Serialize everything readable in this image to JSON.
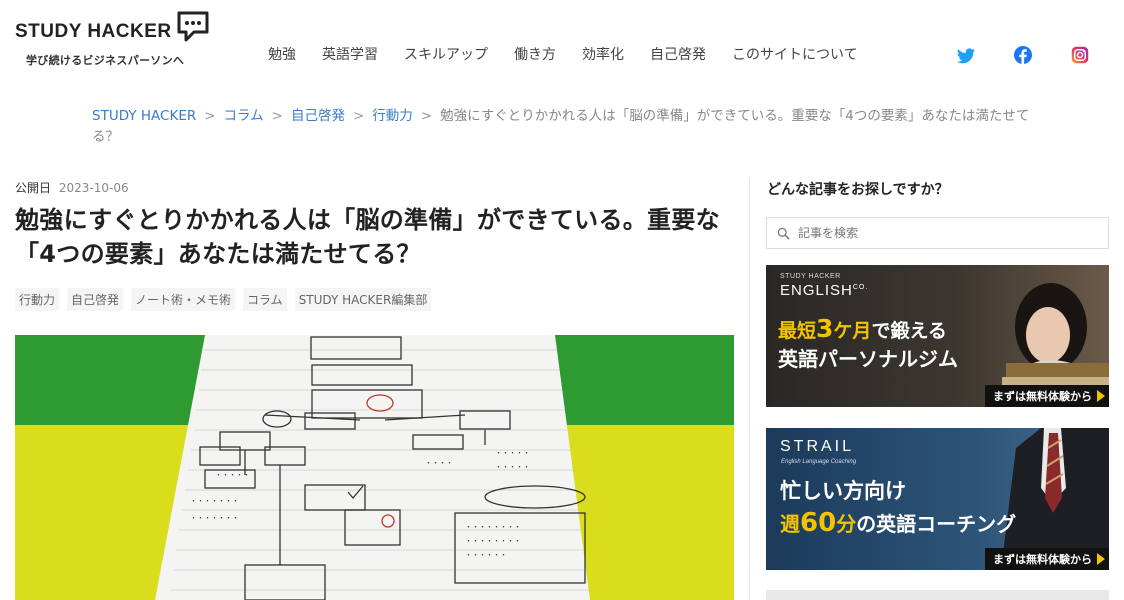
{
  "header": {
    "logo_text": "STUDY HACKER",
    "tagline": "学び続けるビジネスパーソンへ",
    "nav": [
      "勉強",
      "英語学習",
      "スキルアップ",
      "働き方",
      "効率化",
      "自己啓発",
      "このサイトについて"
    ],
    "social": [
      "twitter-icon",
      "facebook-icon",
      "instagram-icon"
    ]
  },
  "breadcrumb": {
    "items": [
      "STUDY HACKER",
      "コラム",
      "自己啓発",
      "行動力"
    ],
    "current": "勉強にすぐとりかかれる人は「脳の準備」ができている。重要な「4つの要素」あなたは満たせてる？",
    "separator": ">"
  },
  "article": {
    "published_label": "公開日",
    "published_date": "2023-10-06",
    "title": "勉強にすぐとりかかれる人は「脳の準備」ができている。重要な「4つの要素」あなたは満たせてる？",
    "tags": [
      "行動力",
      "自己啓発",
      "ノート術・メモ術",
      "コラム",
      "STUDY HACKER編集部"
    ]
  },
  "sidebar": {
    "title": "どんな記事をお探しですか？",
    "search_placeholder": "記事を検索",
    "banners": [
      {
        "brand_small": "STUDY HACKER",
        "brand": "ENGLISH",
        "brand_suffix": "CO.",
        "line1_pre": "最短",
        "line1_num": "3",
        "line1_mid": "ケ月",
        "line1_post": "で鍛える",
        "line2": "英語パーソナルジム",
        "cta": "まずは無料体験から"
      },
      {
        "brand": "STRAIL",
        "sub": "English Language Coaching",
        "line1": "忙しい方向け",
        "line2_pre": "週",
        "line2_num": "60",
        "line2_mid": "分",
        "line2_post": "の英語コーチング",
        "cta": "まずは無料体験から"
      }
    ]
  },
  "colors": {
    "link": "#3a7bc8",
    "accent": "#f3c300",
    "hero_green": "#2e9b32",
    "hero_yellow": "#d9dd1c"
  }
}
